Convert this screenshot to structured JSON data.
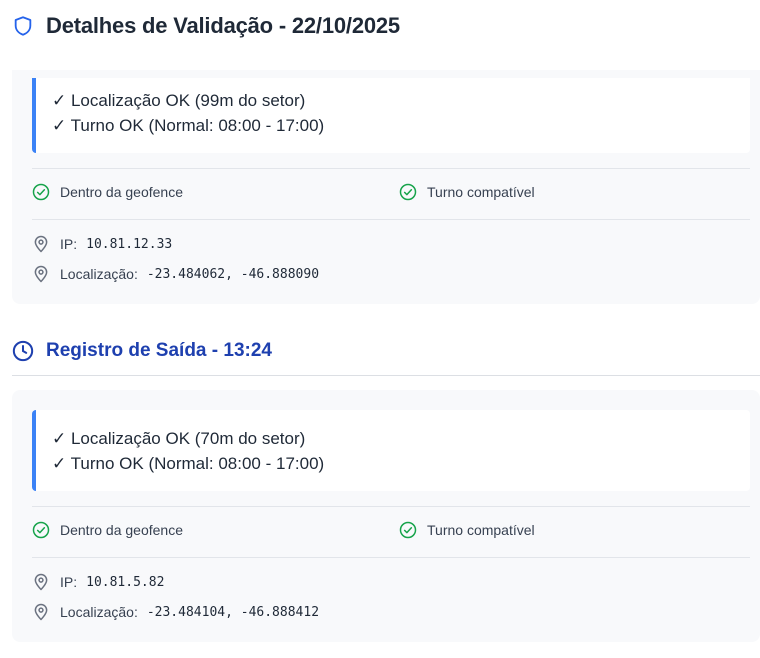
{
  "header": {
    "title": "Detalhes de Validação - 22/10/2025",
    "icon": "shield-icon"
  },
  "entry": {
    "messages": [
      "✓ Localização OK (99m do setor)",
      "✓ Turno OK (Normal: 08:00 - 17:00)"
    ],
    "geofence_label": "Dentro da geofence",
    "shift_label": "Turno compatível",
    "ip_label": "IP:",
    "ip_value": "10.81.12.33",
    "location_label": "Localização:",
    "location_value": "-23.484062, -46.888090"
  },
  "exit_section": {
    "title": "Registro de Saída - 13:24",
    "icon": "clock-icon"
  },
  "exit": {
    "messages": [
      "✓ Localização OK (70m do setor)",
      "✓ Turno OK (Normal: 08:00 - 17:00)"
    ],
    "geofence_label": "Dentro da geofence",
    "shift_label": "Turno compatível",
    "ip_label": "IP:",
    "ip_value": "10.81.5.82",
    "location_label": "Localização:",
    "location_value": "-23.484104, -46.888412"
  },
  "colors": {
    "accent_blue": "#3b82f6",
    "title_blue": "#1e40af",
    "success_green": "#16a34a",
    "muted_icon": "#6b7280"
  }
}
